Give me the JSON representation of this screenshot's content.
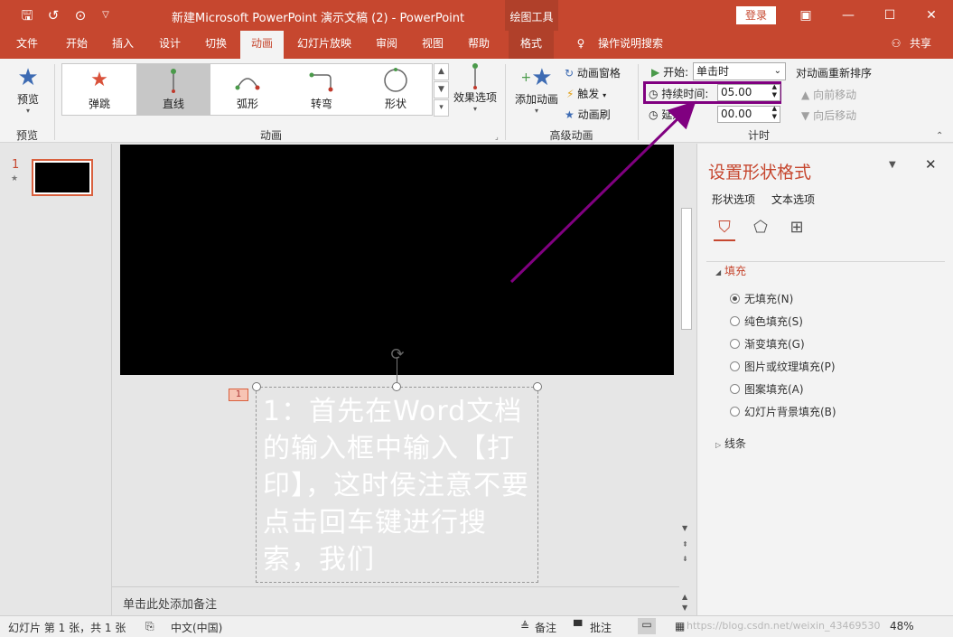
{
  "titlebar": {
    "title": "新建Microsoft PowerPoint 演示文稿 (2)  -  PowerPoint",
    "context_tab": "绘图工具",
    "login": "登录"
  },
  "tabs": [
    "文件",
    "开始",
    "插入",
    "设计",
    "切换",
    "动画",
    "幻灯片放映",
    "审阅",
    "视图",
    "帮助",
    "格式"
  ],
  "tell_me": "操作说明搜索",
  "share": "共享",
  "ribbon": {
    "preview_button": "预览",
    "preview_group": "预览",
    "animations": [
      "弹跳",
      "直线",
      "弧形",
      "转弯",
      "形状"
    ],
    "effect_options": "效果选项",
    "animation_group": "动画",
    "add_animation": "添加动画",
    "animation_pane": "动画窗格",
    "trigger": "触发",
    "animation_painter": "动画刷",
    "advanced_group": "高级动画",
    "start_label": "开始:",
    "start_value": "单击时",
    "duration_label": "持续时间:",
    "duration_value": "05.00",
    "delay_label": "延迟:",
    "delay_value": "00.00",
    "timing_group": "计时",
    "reorder_title": "对动画重新排序",
    "move_earlier": "向前移动",
    "move_later": "向后移动"
  },
  "thumbnail": {
    "number": "1",
    "star": "★"
  },
  "slide": {
    "anim_tag": "1",
    "text": "1：首先在Word文档的输入框中输入【打印】，这时侯注意不要点击回车键进行搜索，我们"
  },
  "notes_placeholder": "单击此处添加备注",
  "pane": {
    "title": "设置形状格式",
    "tab_shape": "形状选项",
    "tab_text": "文本选项",
    "fill_section": "填充",
    "fill_options": [
      "无填充(N)",
      "纯色填充(S)",
      "渐变填充(G)",
      "图片或纹理填充(P)",
      "图案填充(A)",
      "幻灯片背景填充(B)"
    ],
    "line_section": "线条"
  },
  "status": {
    "slide_info": "幻灯片 第 1 张，共 1 张",
    "language": "中文(中国)",
    "notes": "备注",
    "comments": "批注",
    "watermark": "https://blog.csdn.net/weixin_43469530",
    "zoom": "48%"
  },
  "colors": {
    "accent": "#c6472f",
    "highlight": "#800080"
  }
}
